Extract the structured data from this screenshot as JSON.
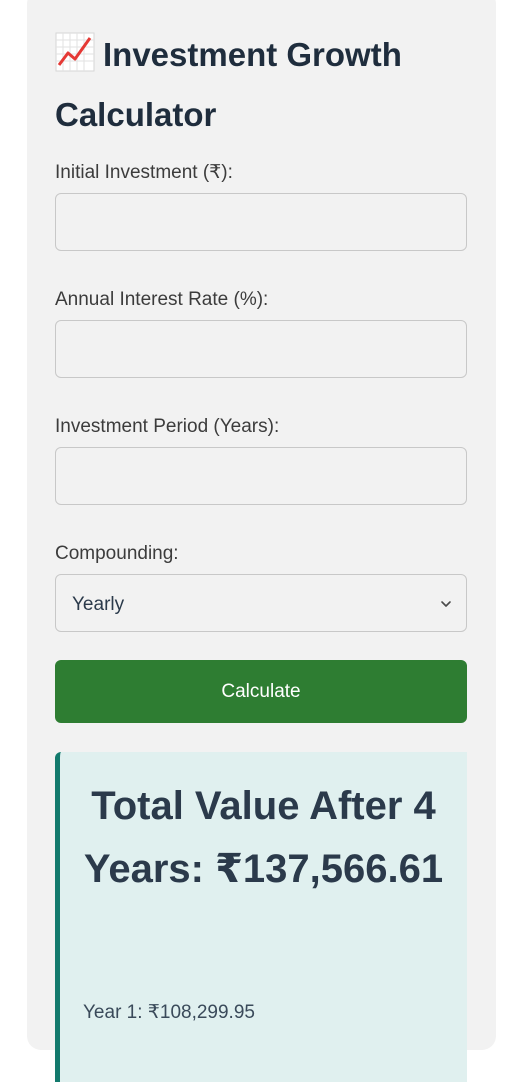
{
  "calculator": {
    "title_icon": "chart-increasing-icon",
    "title": "Investment Growth Calculator",
    "fields": {
      "initial_investment": {
        "label": "Initial Investment (₹):",
        "value": ""
      },
      "interest_rate": {
        "label": "Annual Interest Rate (%):",
        "value": ""
      },
      "period": {
        "label": "Investment Period (Years):",
        "value": ""
      }
    },
    "compounding": {
      "label": "Compounding:",
      "selected": "Yearly"
    },
    "calculate_label": "Calculate"
  },
  "result": {
    "heading": "Total Value After 4 Years: ₹137,566.61",
    "rows": [
      {
        "text": "Year 1: ₹108,299.95"
      }
    ]
  },
  "colors": {
    "button": "#2e7d32",
    "result_border": "#137a6d",
    "result_bg": "#e0f0ef",
    "title": "#1f2d3d"
  }
}
